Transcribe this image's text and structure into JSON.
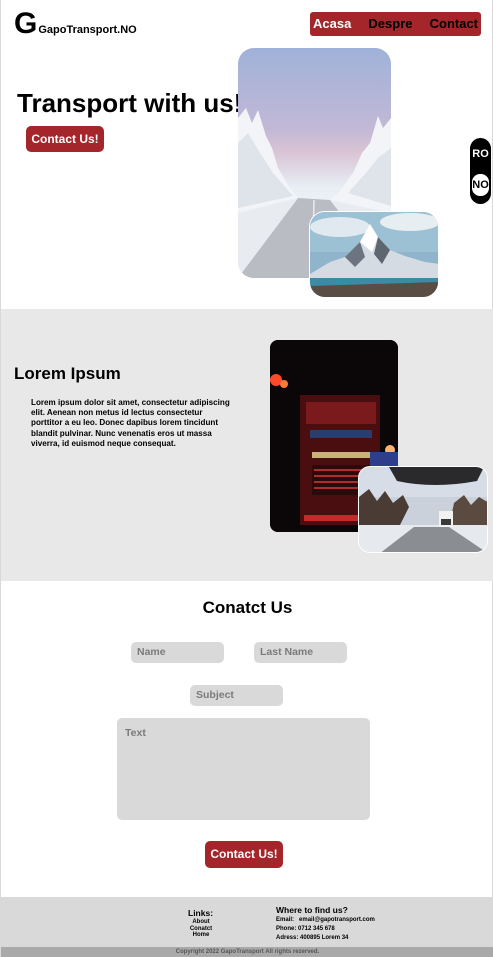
{
  "header": {
    "logo_letter": "G",
    "logo_name": "GapoTransport.NO",
    "nav": [
      {
        "label": "Acasa"
      },
      {
        "label": "Despre"
      },
      {
        "label": "Contact"
      }
    ]
  },
  "hero": {
    "title": "Transport with us!",
    "button_label": "Contact Us!"
  },
  "language_switch": {
    "options": [
      "RO",
      "NO"
    ],
    "selected": "NO"
  },
  "about": {
    "title": "Lorem Ipsum",
    "text": "Lorem ipsum dolor sit amet, consectetur adipiscing elit. Aenean non metus id lectus consectetur porttitor a eu leo. Donec dapibus lorem tincidunt blandit pulvinar. Nunc venenatis eros ut massa viverra, id euismod neque consequat."
  },
  "contact": {
    "title": "Conatct Us",
    "name_placeholder": "Name",
    "last_name_placeholder": "Last Name",
    "subject_placeholder": "Subject",
    "text_placeholder": "Text",
    "button_label": "Contact Us!"
  },
  "footer": {
    "links_title": "Links:",
    "links": [
      "About",
      "Conatct",
      "Home"
    ],
    "where_title": "Where to find us?",
    "email_label": "Email:",
    "email": "email@gapotransport.com",
    "phone": "Phone: 0712 345 678",
    "address": "Adress: 400895 Lorem 34",
    "copyright": "Copyright 2022 GapoTransport All rights rezerved."
  },
  "colors": {
    "accent": "#a4252a",
    "section_gray": "#e8e8e8",
    "field_gray": "#d9d9d9"
  }
}
